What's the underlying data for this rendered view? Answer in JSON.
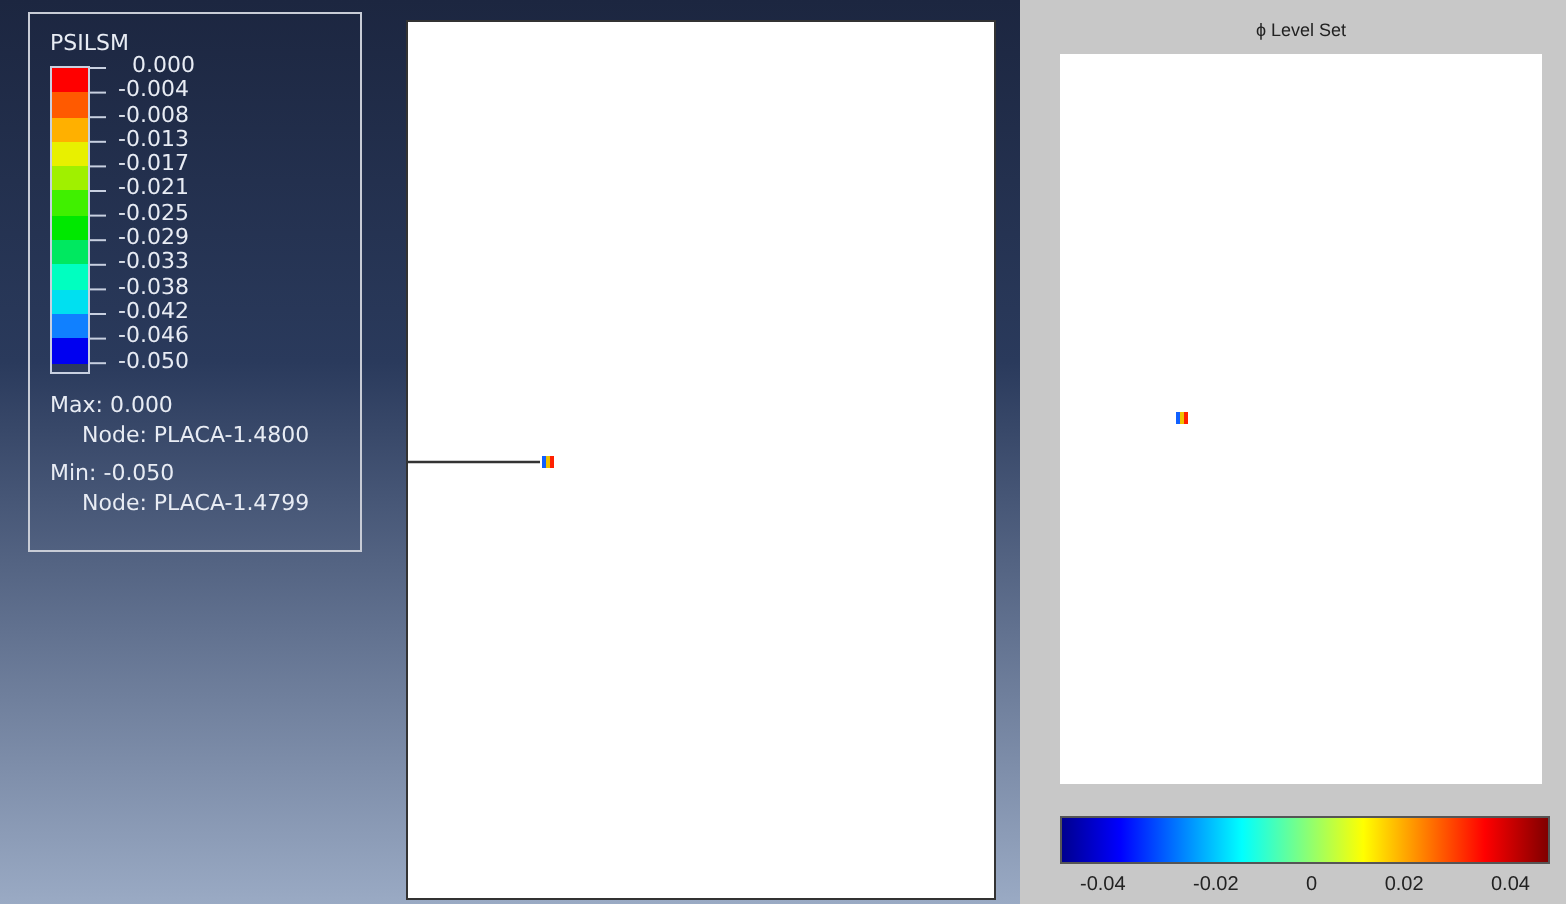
{
  "legend": {
    "title": "PSILSM",
    "bands": [
      {
        "color": "#ff0000"
      },
      {
        "color": "#ff5a00"
      },
      {
        "color": "#ffb000"
      },
      {
        "color": "#e8f000"
      },
      {
        "color": "#a0f000"
      },
      {
        "color": "#40f000"
      },
      {
        "color": "#00e800"
      },
      {
        "color": "#00e860"
      },
      {
        "color": "#00ffc0"
      },
      {
        "color": "#00e0f0"
      },
      {
        "color": "#1080ff"
      },
      {
        "color": "#0000f0"
      }
    ],
    "labels": [
      "0.000",
      "-0.004",
      "-0.008",
      "-0.013",
      "-0.017",
      "-0.021",
      "-0.025",
      "-0.029",
      "-0.033",
      "-0.038",
      "-0.042",
      "-0.046",
      "-0.050"
    ],
    "max": "Max: 0.000",
    "max_node": "Node: PLACA-1.4800",
    "min": "Min: -0.050",
    "min_node": "Node: PLACA-1.4799"
  },
  "plot": {
    "title": "ϕ Level Set",
    "colorbar_ticks": [
      "-0.04",
      "-0.02",
      "0",
      "0.02",
      "0.04"
    ]
  }
}
